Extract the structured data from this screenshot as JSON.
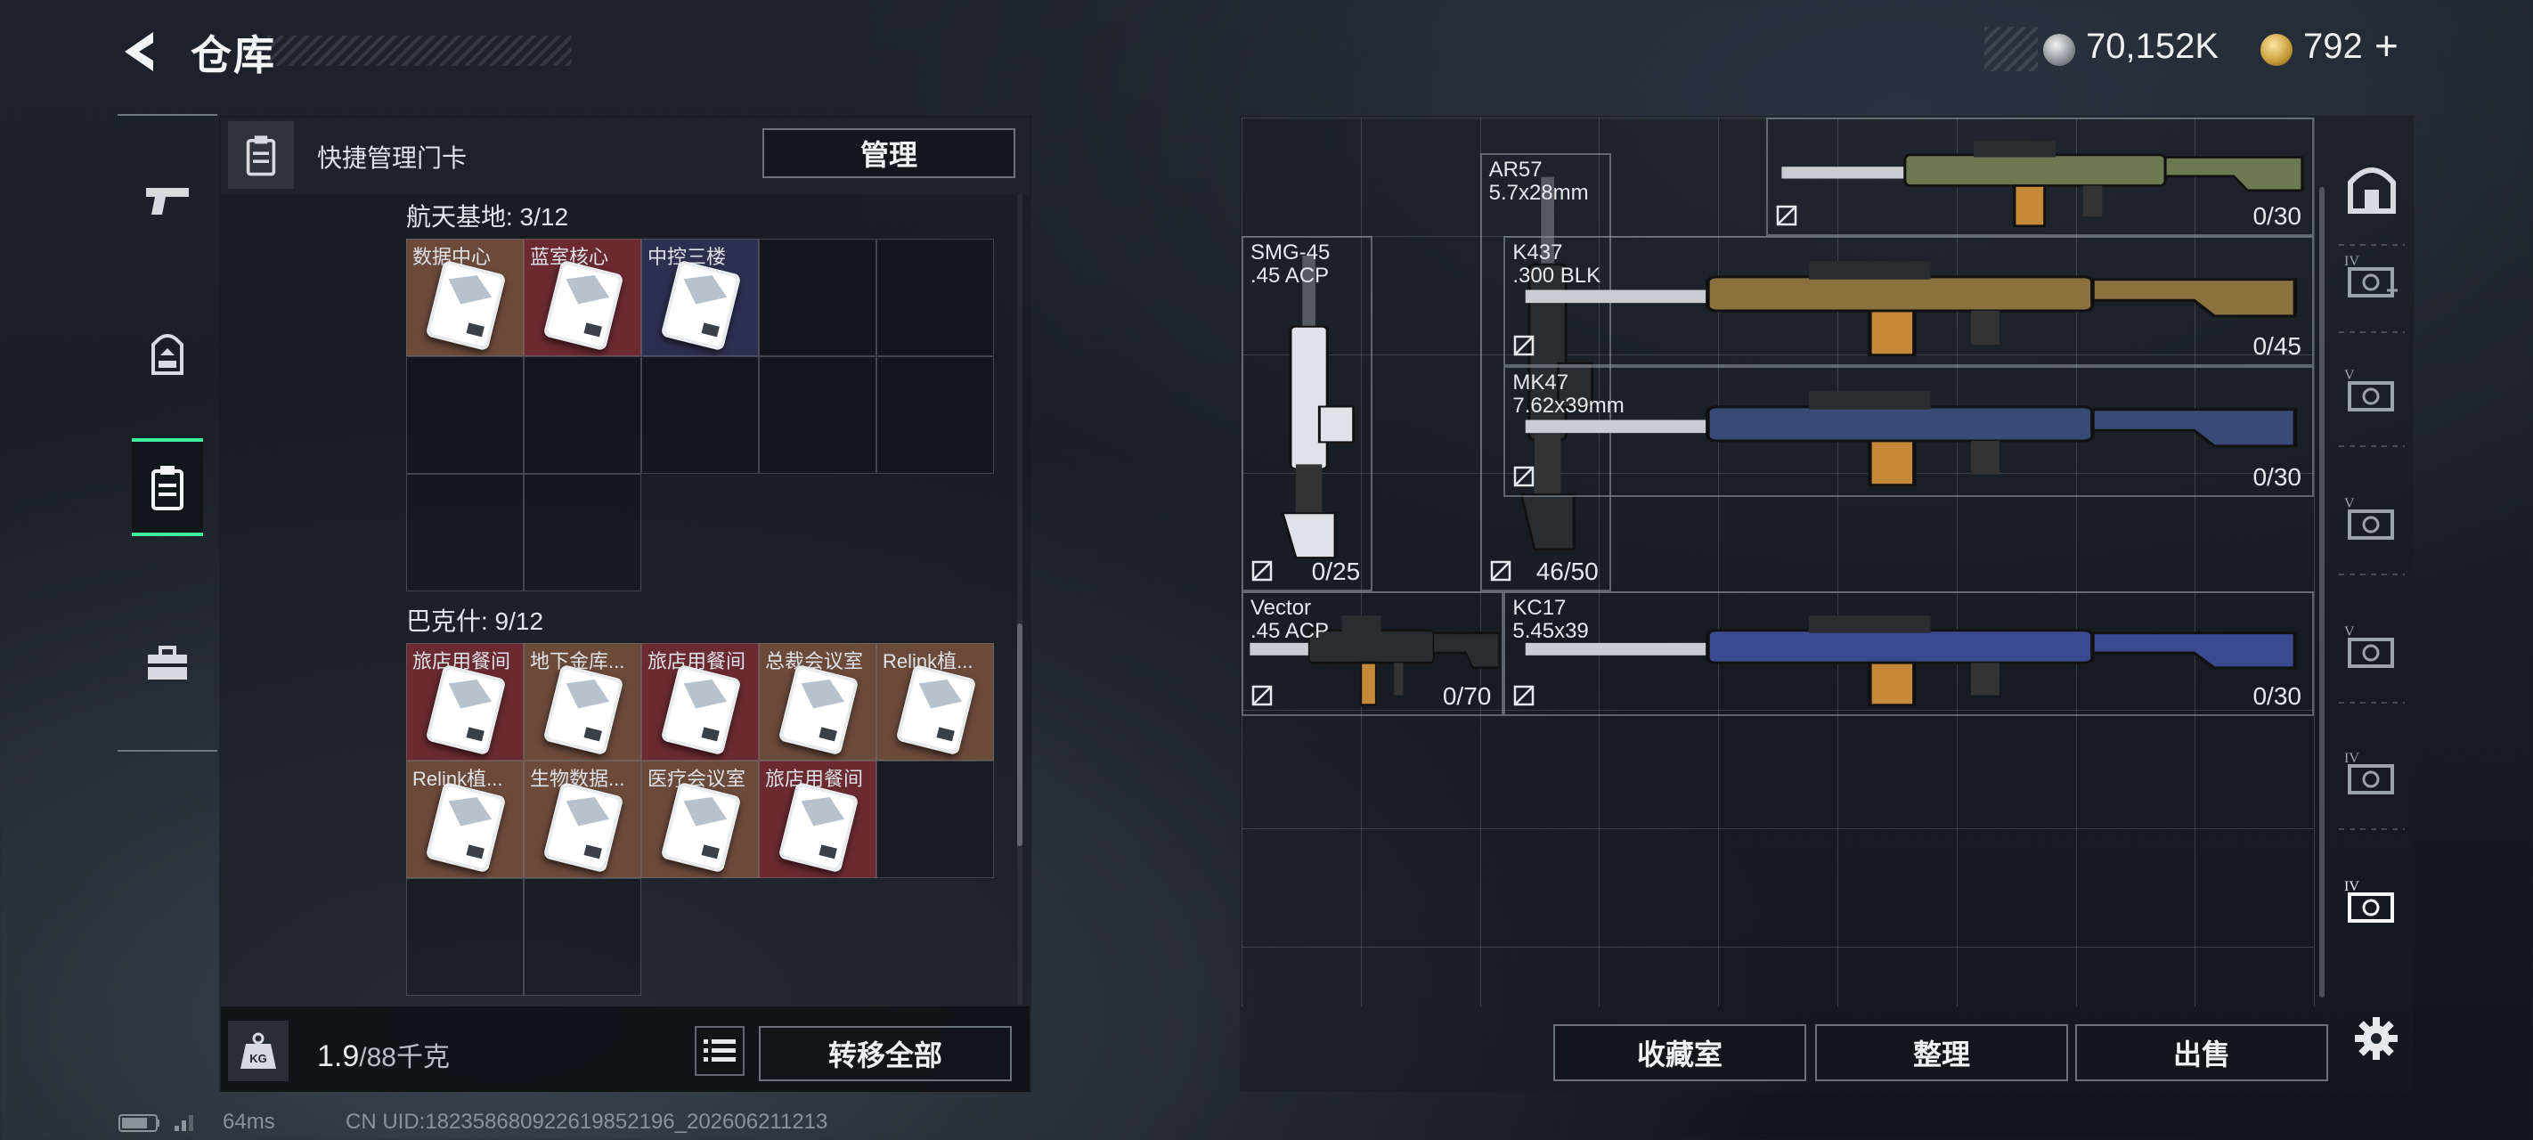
{
  "header": {
    "title": "仓库",
    "currency_silver": "70,152K",
    "currency_gold": "792",
    "plus_label": "+"
  },
  "nav": {
    "items": [
      {
        "name": "weapons",
        "icon": "pistol-icon"
      },
      {
        "name": "equipment",
        "icon": "backpack-icon"
      },
      {
        "name": "keycards",
        "icon": "keycard-icon",
        "active": true
      },
      {
        "name": "supplies",
        "icon": "toolbox-icon"
      }
    ]
  },
  "card_panel": {
    "header_label": "快捷管理门卡",
    "manage_label": "管理",
    "sections": [
      {
        "title": "航天基地: 3/12",
        "cards": [
          {
            "label": "数据中心",
            "color": "#6b4a3a"
          },
          {
            "label": "蓝室核心",
            "color": "#6a2a30"
          },
          {
            "label": "中控三楼",
            "color": "#2c3050"
          }
        ]
      },
      {
        "title": "巴克什: 9/12",
        "cards": [
          {
            "label": "旅店用餐间",
            "color": "#6a2a30"
          },
          {
            "label": "地下金库...",
            "color": "#6b4a3a"
          },
          {
            "label": "旅店用餐间",
            "color": "#6a2a30"
          },
          {
            "label": "总裁会议室",
            "color": "#6b4a3a"
          },
          {
            "label": "Relink植...",
            "color": "#6b4a3a"
          },
          {
            "label": "Relink植...",
            "color": "#6b4a3a"
          },
          {
            "label": "生物数据...",
            "color": "#6b4a3a"
          },
          {
            "label": "医疗会议室",
            "color": "#6b4a3a"
          },
          {
            "label": "旅店用餐间",
            "color": "#6a2a30"
          }
        ]
      }
    ],
    "weight_value": "1.9",
    "weight_capacity": "/88千克",
    "transfer_label": "转移全部"
  },
  "weapons": [
    {
      "name": "",
      "caliber": "",
      "ammo": "0/30"
    },
    {
      "name": "AR57",
      "caliber": "5.7x28mm",
      "ammo": "46/50"
    },
    {
      "name": "SMG-45",
      "caliber": ".45 ACP",
      "ammo": "0/25"
    },
    {
      "name": "K437",
      "caliber": ".300 BLK",
      "ammo": "0/45"
    },
    {
      "name": "MK47",
      "caliber": "7.62x39mm",
      "ammo": "0/30"
    },
    {
      "name": "Vector",
      "caliber": ".45 ACP",
      "ammo": "0/70"
    },
    {
      "name": "KC17",
      "caliber": "5.45x39",
      "ammo": "0/30"
    }
  ],
  "bottom_buttons": {
    "collection": "收藏室",
    "organize": "整理",
    "sell": "出售"
  },
  "side_buttons": [
    {
      "icon": "vault-icon"
    },
    {
      "icon": "expand-case-icon"
    },
    {
      "icon": "case-v-icon-1"
    },
    {
      "icon": "case-v-icon-2"
    },
    {
      "icon": "case-v-icon-3"
    },
    {
      "icon": "case-iv-icon"
    },
    {
      "icon": "case-iv-selected-icon"
    }
  ],
  "status": {
    "ping": "64ms",
    "uid": "CN UID:1823586809226198521​96_202606211213"
  }
}
